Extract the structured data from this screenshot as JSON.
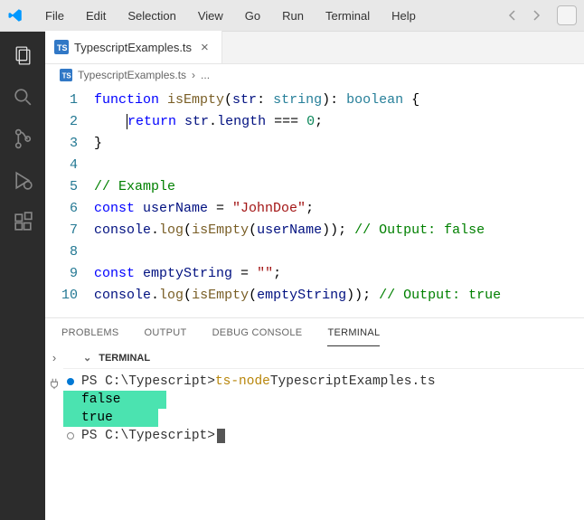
{
  "menu": {
    "file": "File",
    "edit": "Edit",
    "selection": "Selection",
    "view": "View",
    "go": "Go",
    "run": "Run",
    "terminal": "Terminal",
    "help": "Help"
  },
  "tab": {
    "icon": "TS",
    "filename": "TypescriptExamples.ts"
  },
  "breadcrumb": {
    "icon": "TS",
    "filename": "TypescriptExamples.ts",
    "sep": "›",
    "rest": "..."
  },
  "code": {
    "l1": {
      "n": "1",
      "kw1": "function",
      "fn": " isEmpty",
      "p1": "(",
      "v1": "str",
      "p2": ": ",
      "ty": "string",
      "p3": "): ",
      "ty2": "boolean",
      "p4": " {"
    },
    "l2": {
      "n": "2",
      "kw": "return",
      "v": " str",
      "p1": ".",
      "pr": "length",
      "p2": " === ",
      "nu": "0",
      "p3": ";"
    },
    "l3": {
      "n": "3",
      "b": "}"
    },
    "l4": {
      "n": "4"
    },
    "l5": {
      "n": "5",
      "c": "// Example"
    },
    "l6": {
      "n": "6",
      "kw": "const",
      "v": " userName",
      "p1": " = ",
      "s": "\"JohnDoe\"",
      "p2": ";"
    },
    "l7": {
      "n": "7",
      "o": "console",
      "p1": ".",
      "m": "log",
      "p2": "(",
      "fn": "isEmpty",
      "p3": "(",
      "v": "userName",
      "p4": ")); ",
      "c": "// Output: false"
    },
    "l8": {
      "n": "8"
    },
    "l9": {
      "n": "9",
      "kw": "const",
      "v": " emptyString",
      "p1": " = ",
      "s": "\"\"",
      "p2": ";"
    },
    "l10": {
      "n": "10",
      "o": "console",
      "p1": ".",
      "m": "log",
      "p2": "(",
      "fn": "isEmpty",
      "p3": "(",
      "v": "emptyString",
      "p4": ")); ",
      "c": "// Output: true"
    }
  },
  "panel": {
    "problems": "PROBLEMS",
    "output": "OUTPUT",
    "debug": "DEBUG CONSOLE",
    "terminal": "TERMINAL"
  },
  "term": {
    "header": "TERMINAL",
    "l1": {
      "prompt": "PS C:\\Typescript> ",
      "cmd1": "ts-node",
      "cmd2": " TypescriptExamples.ts"
    },
    "out1": "false",
    "out2": "true",
    "l2": {
      "prompt": "PS C:\\Typescript> "
    }
  }
}
